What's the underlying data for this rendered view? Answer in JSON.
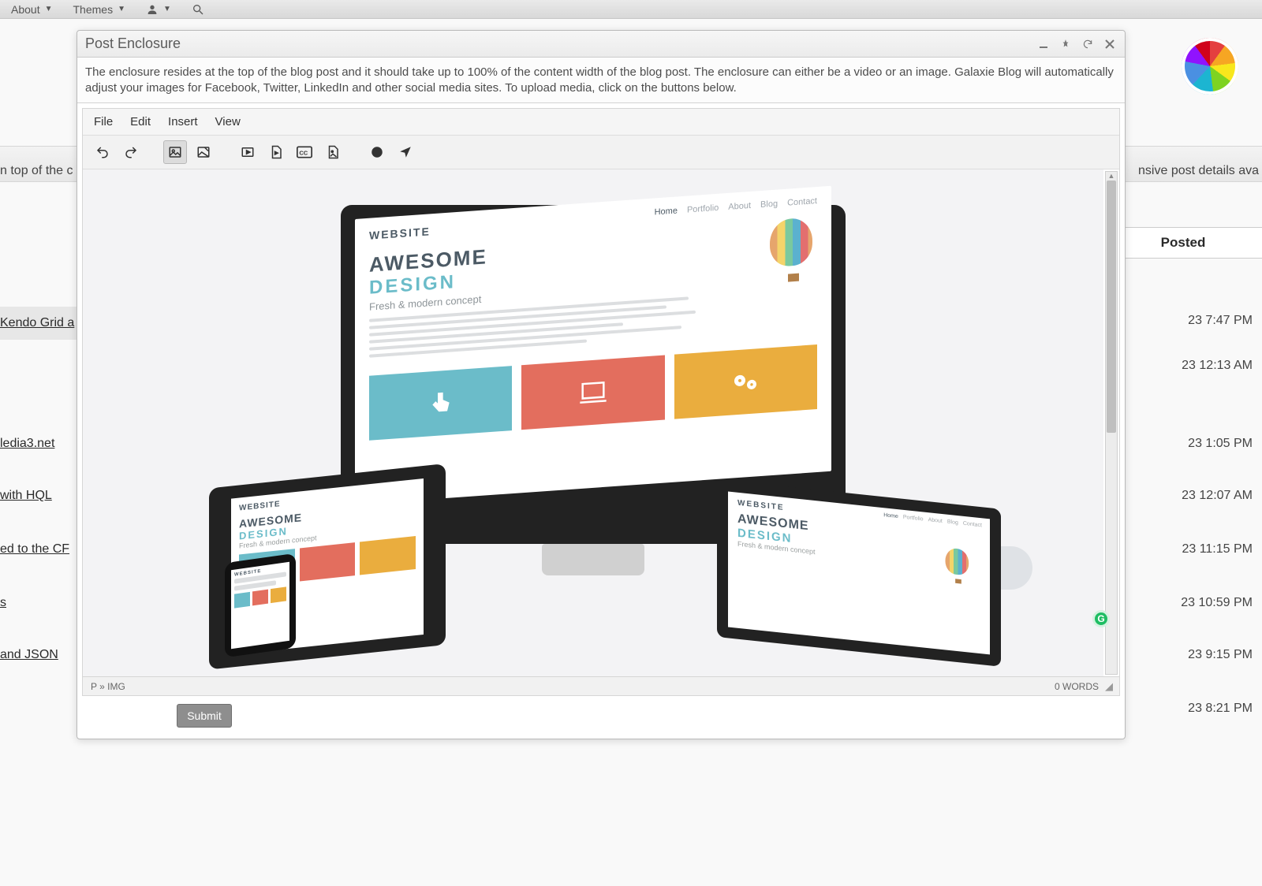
{
  "topNav": {
    "about": "About",
    "themes": "Themes"
  },
  "background": {
    "leftHint1": "n top of the c",
    "rightHint1": "nsive post details ava",
    "postedHeader": "Posted",
    "rows": [
      {
        "left": "Kendo Grid a",
        "right": "23 7:47 PM",
        "topLeft": 389,
        "topRight": 398
      },
      {
        "left": "",
        "right": "23 12:13 AM",
        "topLeft": 455,
        "topRight": 455
      },
      {
        "left": "ledia3.net",
        "right": "23 1:05 PM",
        "topLeft": 554,
        "topRight": 554
      },
      {
        "left": "with HQL",
        "right": "23 12:07 AM",
        "topLeft": 620,
        "topRight": 620
      },
      {
        "left": "ed to the CF",
        "right": "23 11:15 PM",
        "topLeft": 688,
        "topRight": 688
      },
      {
        "left": "s",
        "right": "23 10:59 PM",
        "topLeft": 756,
        "topRight": 756
      },
      {
        "left": "and JSON",
        "right": "23 9:15 PM",
        "topLeft": 822,
        "topRight": 822
      },
      {
        "left": "",
        "right": "23 8:21 PM",
        "topLeft": 890,
        "topRight": 890
      }
    ]
  },
  "dialog": {
    "title": "Post Enclosure",
    "helpText": "The enclosure resides at the top of the blog post and it should take up to 100% of the content width of the blog post. The enclosure can either be a video or an image. Galaxie Blog will automatically adjust your images for Facebook, Twitter, LinkedIn and other social media sites. To upload media, click on the buttons below.",
    "menu": {
      "file": "File",
      "edit": "Edit",
      "insert": "Insert",
      "view": "View"
    },
    "status": {
      "path": "P » IMG",
      "words": "0 WORDS"
    },
    "submit": "Submit"
  },
  "mockup": {
    "nav": {
      "home": "Home",
      "portfolio": "Portfolio",
      "about": "About",
      "blog": "Blog",
      "contact": "Contact"
    },
    "logo": "WEBSITE",
    "headline1": "AWESOME",
    "headline2": "DESIGN",
    "sub": "Fresh & modern concept"
  }
}
